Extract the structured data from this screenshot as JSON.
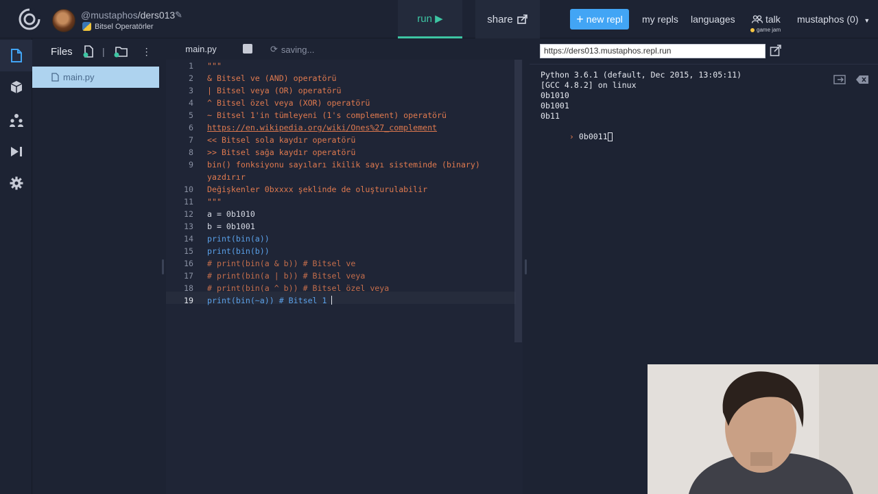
{
  "header": {
    "username": "@mustaphos",
    "repl_name": "/ders013",
    "language_label": "Bitsel Operatörler",
    "run_label": "run ▶",
    "share_label": "share",
    "new_repl_label": "new repl",
    "my_repls_label": "my repls",
    "languages_label": "languages",
    "talk_label": "talk",
    "game_jam_label": "game jam",
    "user_menu_label": "mustaphos (0)"
  },
  "files": {
    "title": "Files",
    "items": [
      {
        "label": "main.py"
      }
    ]
  },
  "editor": {
    "tab_label": "main.py",
    "status": "saving...",
    "lines": [
      {
        "n": "1",
        "text": "\"\"\""
      },
      {
        "n": "2",
        "text": "& Bitsel ve (AND) operatörü"
      },
      {
        "n": "3",
        "text": "| Bitsel veya (OR) operatörü"
      },
      {
        "n": "4",
        "text": "^ Bitsel özel veya (XOR) operatörü"
      },
      {
        "n": "5",
        "text": "~ Bitsel 1'in tümleyeni (1's complement) operatörü"
      },
      {
        "n": "6",
        "text": "https://en.wikipedia.org/wiki/Ones%27_complement"
      },
      {
        "n": "7",
        "text": "<< Bitsel sola kaydır operatörü"
      },
      {
        "n": "8",
        "text": ">> Bitsel sağa kaydır operatörü"
      },
      {
        "n": "9",
        "text": "bin() fonksiyonu sayıları ikilik sayı sisteminde (binary)"
      },
      {
        "n": "",
        "text": "yazdırır"
      },
      {
        "n": "10",
        "text": "Değişkenler 0bxxxx şeklinde de oluşturulabilir"
      },
      {
        "n": "11",
        "text": "\"\"\""
      },
      {
        "n": "12",
        "text": "a = 0b1010"
      },
      {
        "n": "13",
        "text": "b = 0b1001"
      },
      {
        "n": "14",
        "text": "print(bin(a))"
      },
      {
        "n": "15",
        "text": "print(bin(b))"
      },
      {
        "n": "16",
        "text": "# print(bin(a & b)) # Bitsel ve"
      },
      {
        "n": "17",
        "text": "# print(bin(a | b)) # Bitsel veya"
      },
      {
        "n": "18",
        "text": "# print(bin(a ^ b)) # Bitsel özel veya"
      },
      {
        "n": "19",
        "text": "print(bin(~a)) # Bitsel 1"
      }
    ]
  },
  "console": {
    "url": "https://ders013.mustaphos.repl.run",
    "output": [
      "Python 3.6.1 (default, Dec 2015, 13:05:11)",
      "[GCC 4.8.2] on linux",
      "0b1010",
      "0b1001",
      "0b11"
    ],
    "prompt_symbol": "›",
    "input": "0b0011"
  },
  "colors": {
    "accent": "#3dc5a3",
    "new_repl": "#42a5f5",
    "string": "#e07a4f",
    "keyword": "#5aa0e8"
  }
}
